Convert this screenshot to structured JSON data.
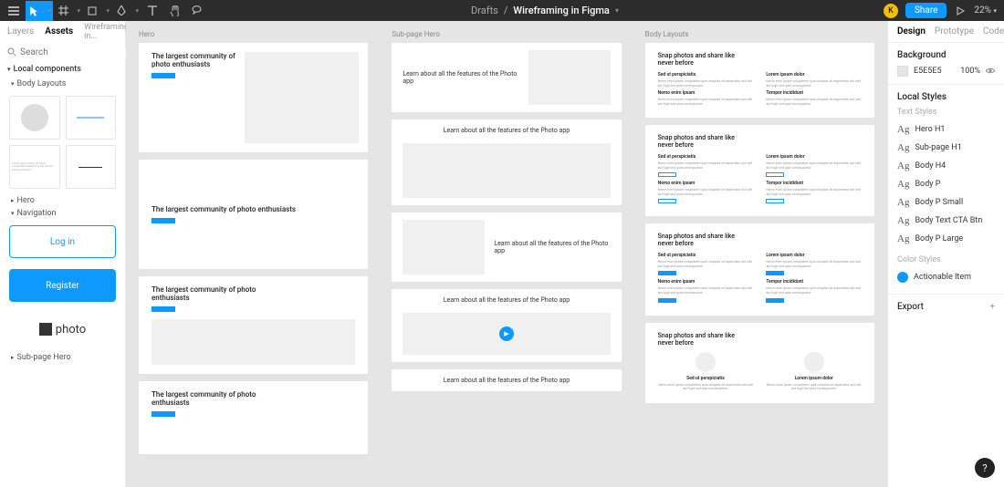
{
  "toolbar": {
    "breadcrumb_parent": "Drafts",
    "breadcrumb_sep": "/",
    "title": "Wireframing in Figma",
    "share_label": "Share",
    "zoom": "22%",
    "avatar_initial": "K"
  },
  "left_panel": {
    "tabs": {
      "layers": "Layers",
      "assets": "Assets"
    },
    "file_selector": "Wireframing in...",
    "search_placeholder": "Search",
    "local_components": "Local components",
    "sections": {
      "body_layouts": "Body Layouts",
      "hero": "Hero",
      "navigation": "Navigation",
      "subpage_hero": "Sub-page Hero"
    },
    "nav_items": {
      "login": "Log in",
      "register": "Register",
      "logo": "photo"
    }
  },
  "canvas": {
    "col1_label": "Hero",
    "col2_label": "Sub-page Hero",
    "col3_label": "Body Layouts",
    "hero_title": "The largest community of photo enthusiasts",
    "sub_title": "Learn about all the features of the Photo app",
    "body_title": "Snap photos and share like never before",
    "lorem_h1": "Sed ut perspiciatis",
    "lorem_h2": "Lorem ipsum dolor",
    "lorem_h3": "Nemo enim ipsam",
    "lorem_h4": "Tempor incididunt",
    "lorem_p": "Nemo enim ipsam voluptatem quia voluptas sit aspernatur aut odit aut fugit sed quia consequuntur"
  },
  "right_panel": {
    "tabs": {
      "design": "Design",
      "prototype": "Prototype",
      "code": "Code"
    },
    "background": {
      "title": "Background",
      "hex": "E5E5E5",
      "opacity": "100%"
    },
    "local_styles": "Local Styles",
    "text_styles": "Text Styles",
    "color_styles": "Color Styles",
    "styles": [
      "Hero H1",
      "Sub-page H1",
      "Body H4",
      "Body P",
      "Body P Small",
      "Body Text CTA Btn",
      "Body P Large"
    ],
    "actionable_item": "Actionable Item",
    "export": "Export"
  },
  "help": "?"
}
